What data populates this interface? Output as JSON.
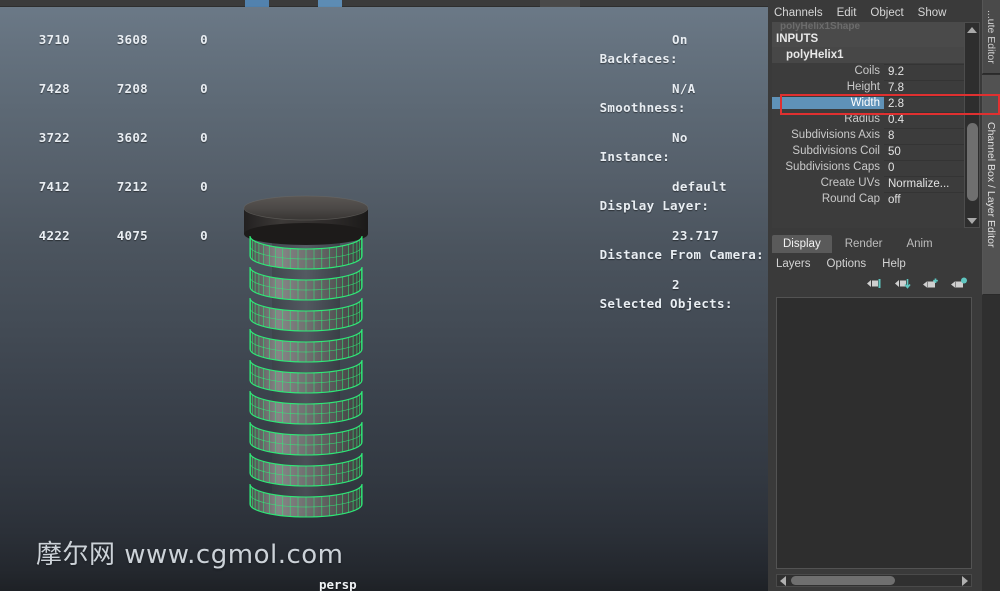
{
  "viewport": {
    "camera_label": "persp",
    "watermark": "摩尔网 www.cgmol.com",
    "hud_left": {
      "rows": [
        {
          "c1": "3710",
          "c2": "3608",
          "c3": "0"
        },
        {
          "c1": "7428",
          "c2": "7208",
          "c3": "0"
        },
        {
          "c1": "3722",
          "c2": "3602",
          "c3": "0"
        },
        {
          "c1": "7412",
          "c2": "7212",
          "c3": "0"
        },
        {
          "c1": "4222",
          "c2": "4075",
          "c3": "0"
        }
      ]
    },
    "hud_right": {
      "rows": [
        {
          "label": "Backfaces:",
          "value": "On"
        },
        {
          "label": "Smoothness:",
          "value": "N/A"
        },
        {
          "label": "Instance:",
          "value": "No"
        },
        {
          "label": "Display Layer:",
          "value": "default"
        },
        {
          "label": "Distance From Camera:",
          "value": "23.717"
        },
        {
          "label": "Selected Objects:",
          "value": "2"
        }
      ]
    },
    "model": {
      "name": "helix-spring-with-cap",
      "wireframe_color": "#2ff07a",
      "surface_color": "#6b6b6b",
      "cap_color": "#4e4b49"
    }
  },
  "channel_box": {
    "menu": [
      "Channels",
      "Edit",
      "Object",
      "Show"
    ],
    "ghost_row": "polyHelix1Shape",
    "section_label": "INPUTS",
    "node_name": "polyHelix1",
    "attributes": [
      {
        "key": "Coils",
        "value": "9.2",
        "selected": false
      },
      {
        "key": "Height",
        "value": "7.8",
        "selected": false
      },
      {
        "key": "Width",
        "value": "2.8",
        "selected": true
      },
      {
        "key": "Radius",
        "value": "0.4",
        "selected": false
      },
      {
        "key": "Subdivisions Axis",
        "value": "8",
        "selected": false
      },
      {
        "key": "Subdivisions Coil",
        "value": "50",
        "selected": false
      },
      {
        "key": "Subdivisions Caps",
        "value": "0",
        "selected": false
      },
      {
        "key": "Create UVs",
        "value": "Normalize...",
        "selected": false
      },
      {
        "key": "Round Cap",
        "value": "off",
        "selected": false
      }
    ],
    "selection_color": "#5f92b8"
  },
  "annotation": {
    "color": "#e03030",
    "target": "Width"
  },
  "layer_editor": {
    "tabs": [
      {
        "label": "Display",
        "active": true
      },
      {
        "label": "Render",
        "active": false
      },
      {
        "label": "Anim",
        "active": false
      }
    ],
    "menu": [
      "Layers",
      "Options",
      "Help"
    ],
    "icons": [
      "new-layer-from-selected-icon",
      "new-layer-icon",
      "add-selected-to-layer-icon",
      "remove-selected-from-layer-icon"
    ],
    "layers": []
  },
  "vertical_tabs": [
    {
      "label": "...ute Editor",
      "active": false
    },
    {
      "label": "Channel Box / Layer Editor",
      "active": true
    }
  ]
}
